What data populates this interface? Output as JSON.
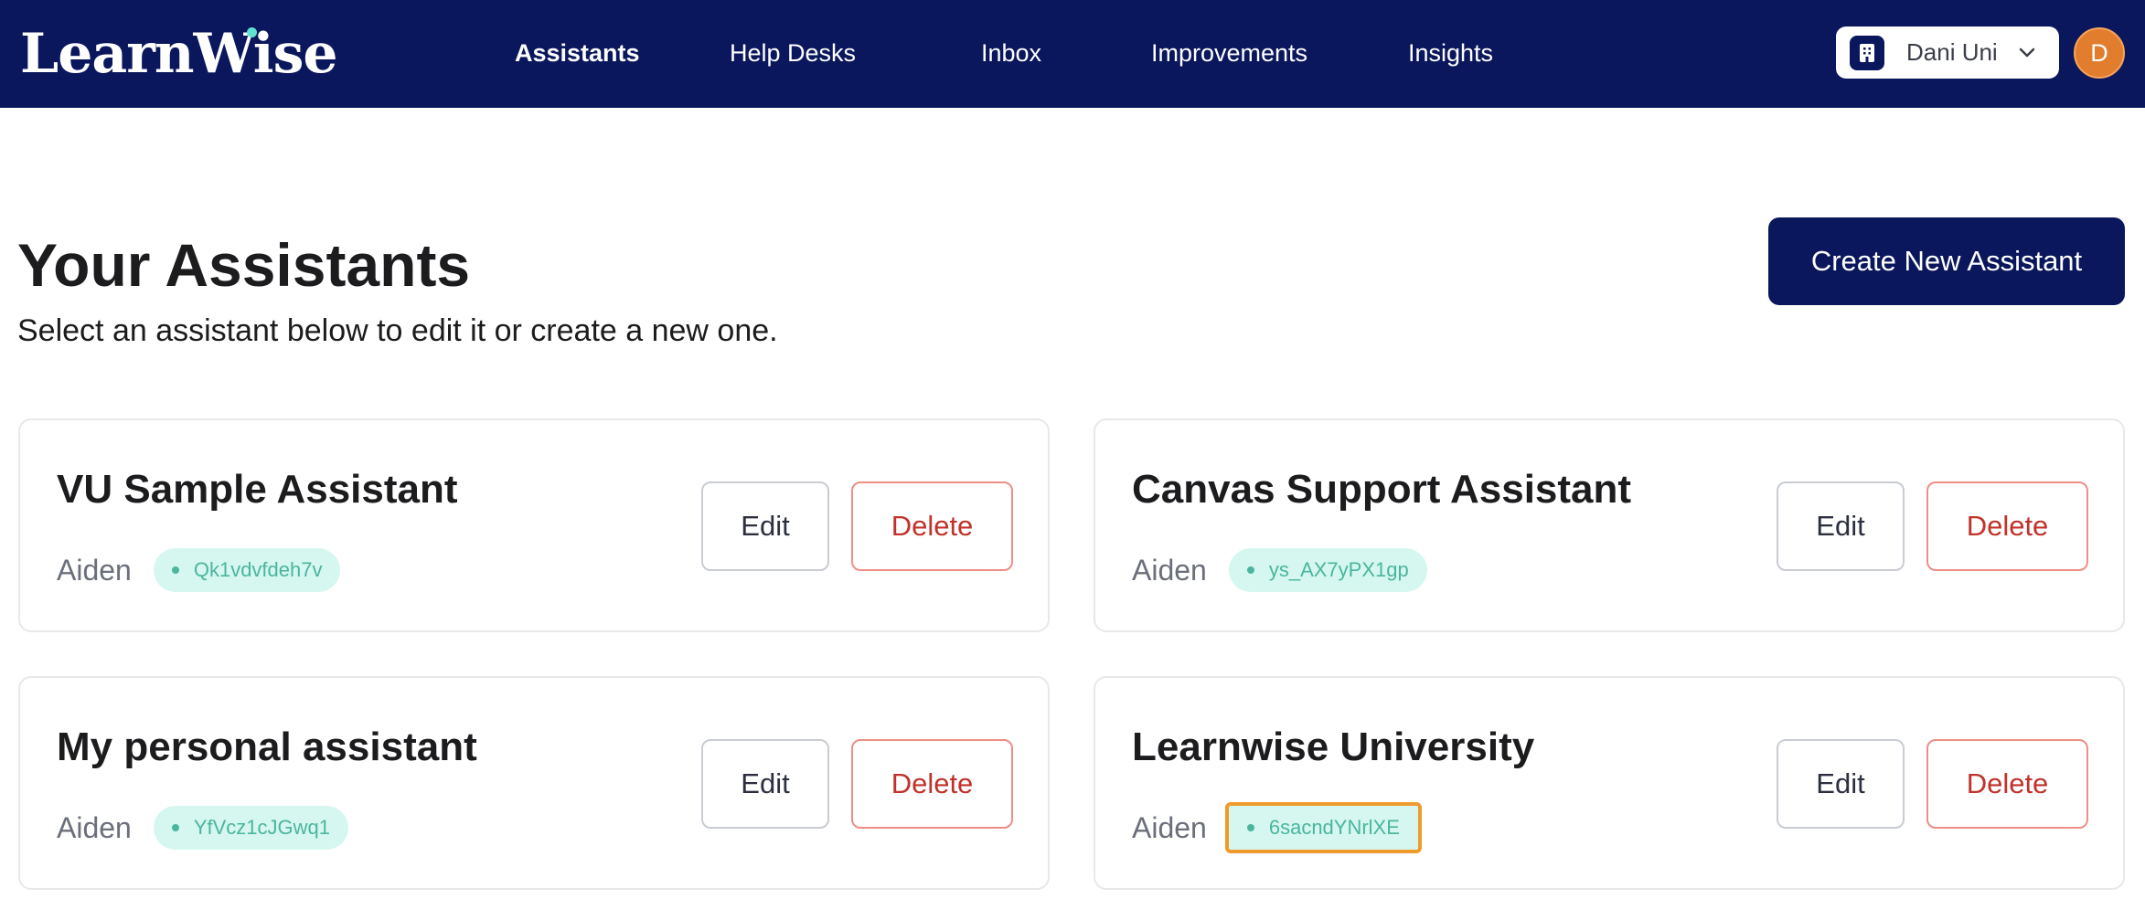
{
  "app": {
    "logo_text": "LearnWise"
  },
  "nav": {
    "items": [
      {
        "label": "Assistants",
        "active": true
      },
      {
        "label": "Help Desks",
        "active": false
      },
      {
        "label": "Inbox",
        "active": false
      },
      {
        "label": "Improvements",
        "active": false
      },
      {
        "label": "Insights",
        "active": false
      }
    ]
  },
  "org_selector": {
    "label": "Dani Uni",
    "icon": "building-icon",
    "chevron_icon": "chevron-down-icon"
  },
  "user": {
    "avatar_initial": "D",
    "avatar_color": "#e27d2e"
  },
  "page": {
    "title": "Your Assistants",
    "subtitle": "Select an assistant below to edit it or create a new one.",
    "create_button_label": "Create New Assistant"
  },
  "assistants": [
    {
      "name": "VU Sample Assistant",
      "owner": "Aiden",
      "id": "Qk1vdvfdeh7v",
      "edit_label": "Edit",
      "delete_label": "Delete",
      "highlighted": false
    },
    {
      "name": "Canvas Support Assistant",
      "owner": "Aiden",
      "id": "ys_AX7yPX1gp",
      "edit_label": "Edit",
      "delete_label": "Delete",
      "highlighted": false
    },
    {
      "name": "My personal assistant",
      "owner": "Aiden",
      "id": "YfVcz1cJGwq1",
      "edit_label": "Edit",
      "delete_label": "Delete",
      "highlighted": false
    },
    {
      "name": "Learnwise University",
      "owner": "Aiden",
      "id": "6sacndYNrlXE",
      "edit_label": "Edit",
      "delete_label": "Delete",
      "highlighted": true
    }
  ],
  "colors": {
    "brand_navy": "#0b175c",
    "id_badge_bg": "#d5f7ef",
    "id_badge_text": "#4bb59e",
    "delete_red": "#c0322b",
    "highlight_orange": "#ef9a2d"
  }
}
